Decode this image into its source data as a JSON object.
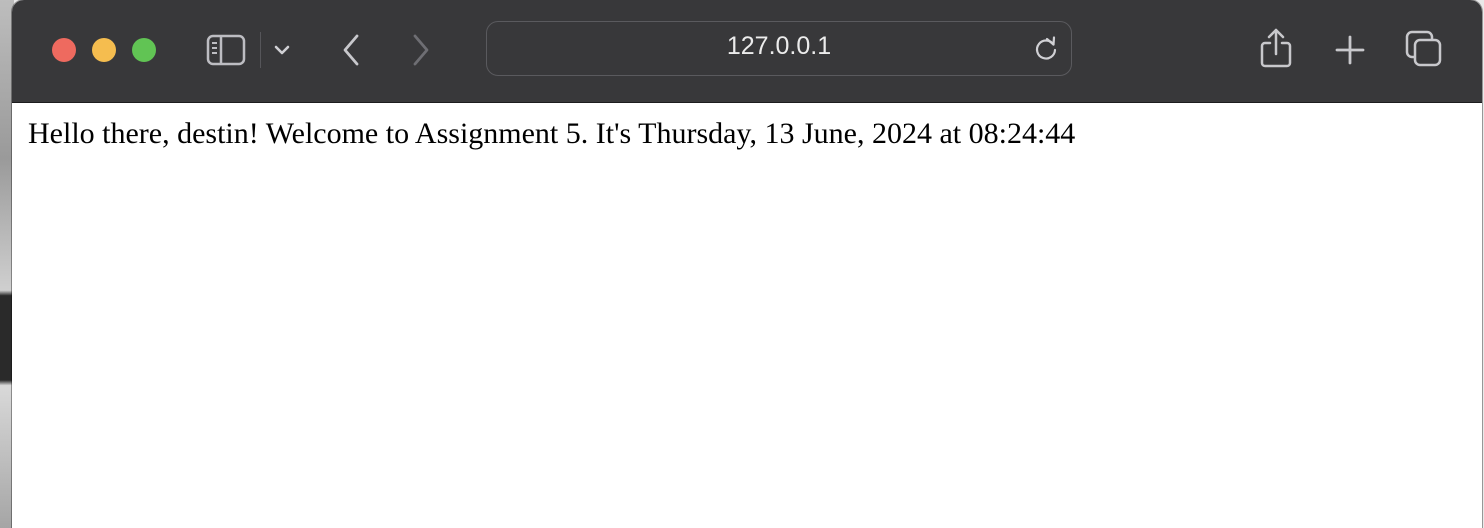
{
  "browser": {
    "address_bar": {
      "url": "127.0.0.1"
    },
    "icons": {
      "sidebar": "sidebar-icon",
      "sidebar_menu": "chevron-down-icon",
      "back": "chevron-left-icon",
      "forward": "chevron-right-icon",
      "reload": "reload-icon",
      "share": "share-icon",
      "new_tab": "plus-icon",
      "tab_overview": "tabs-icon"
    },
    "colors": {
      "close": "#ee6a5f",
      "minimize": "#f5bd4f",
      "maximize": "#61c454",
      "toolbar": "#38383a"
    }
  },
  "page": {
    "greeting": "Hello there, destin! Welcome to Assignment 5. It's Thursday, 13 June, 2024 at 08:24:44"
  }
}
